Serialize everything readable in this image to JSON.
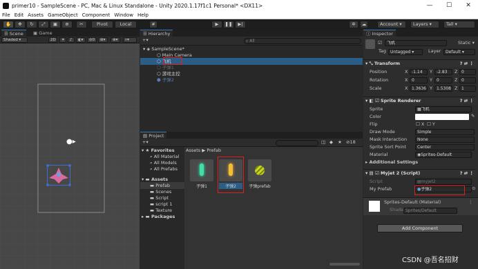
{
  "window": {
    "title": "primer10 - SampleScene - PC, Mac & Linux Standalone - Unity 2020.1.17f1c1 Personal* <DX11>",
    "min": "—",
    "max": "☐",
    "close": "✕"
  },
  "menu": [
    "File",
    "Edit",
    "Assets",
    "GameObject",
    "Component",
    "Window",
    "Help"
  ],
  "toolbar": {
    "pivot": "Pivot",
    "local": "Local",
    "account": "Account",
    "layers": "Layers",
    "layout": "Tall"
  },
  "scene": {
    "tab_scene": "Scene",
    "tab_game": "Game",
    "shading": "Shaded",
    "mode_2d": "2D"
  },
  "hierarchy": {
    "tab": "Hierarchy",
    "add": "+▾",
    "search_placeholder": "All",
    "scene_name": "SampleScene*",
    "items": [
      "Main Camera",
      "飞机",
      "子弹1",
      "游戏主控",
      "子弹2"
    ]
  },
  "project": {
    "tab": "Project",
    "add": "+▾",
    "count": "18",
    "favorites": "Favorites",
    "fav_items": [
      "All Material",
      "All Models",
      "All Prefabs"
    ],
    "assets": "Assets",
    "asset_folders": [
      "Prefab",
      "Scenes",
      "Script",
      "script 1",
      "Texture"
    ],
    "packages": "Packages",
    "breadcrumb_root": "Assets",
    "breadcrumb_sep": "▶",
    "breadcrumb_leaf": "Prefab",
    "prefabs": [
      "子弹1",
      "子弹2",
      "子弹prefab"
    ]
  },
  "inspector": {
    "tab": "Inspector",
    "object_name": "飞机",
    "static": "Static ▾",
    "tag_label": "Tag",
    "tag_value": "Untagged",
    "layer_label": "Layer",
    "layer_value": "Default",
    "transform": {
      "title": "Transform",
      "position_label": "Position",
      "px": "-1.14",
      "py": "-2.83",
      "pz": "0",
      "rotation_label": "Rotation",
      "rx": "0",
      "ry": "0",
      "rz": "0",
      "scale_label": "Scale",
      "sx": "1.3636",
      "sy": "1.5308",
      "sz": "1"
    },
    "sprite_renderer": {
      "title": "Sprite Renderer",
      "sprite_label": "Sprite",
      "sprite_value": "飞机",
      "color_label": "Color",
      "flip_label": "Flip",
      "flip_x": "X",
      "flip_y": "Y",
      "draw_mode_label": "Draw Mode",
      "draw_mode_value": "Simple",
      "mask_label": "Mask Interaction",
      "mask_value": "None",
      "sort_label": "Sprite Sort Point",
      "sort_value": "Center",
      "material_label": "Material",
      "material_value": "Sprites-Default"
    },
    "additional": "Additional Settings",
    "script_comp": {
      "title": "Myjet 2 (Script)",
      "script_label": "Script",
      "script_value": "myjet2",
      "prefab_label": "My Prefab",
      "prefab_value": "子弹2"
    },
    "material": {
      "title": "Sprites-Default (Material)",
      "shader_label": "Shader",
      "shader_value": "Sprites/Default"
    },
    "add_component": "Add Component"
  },
  "watermark": "CSDN @吾名招财"
}
